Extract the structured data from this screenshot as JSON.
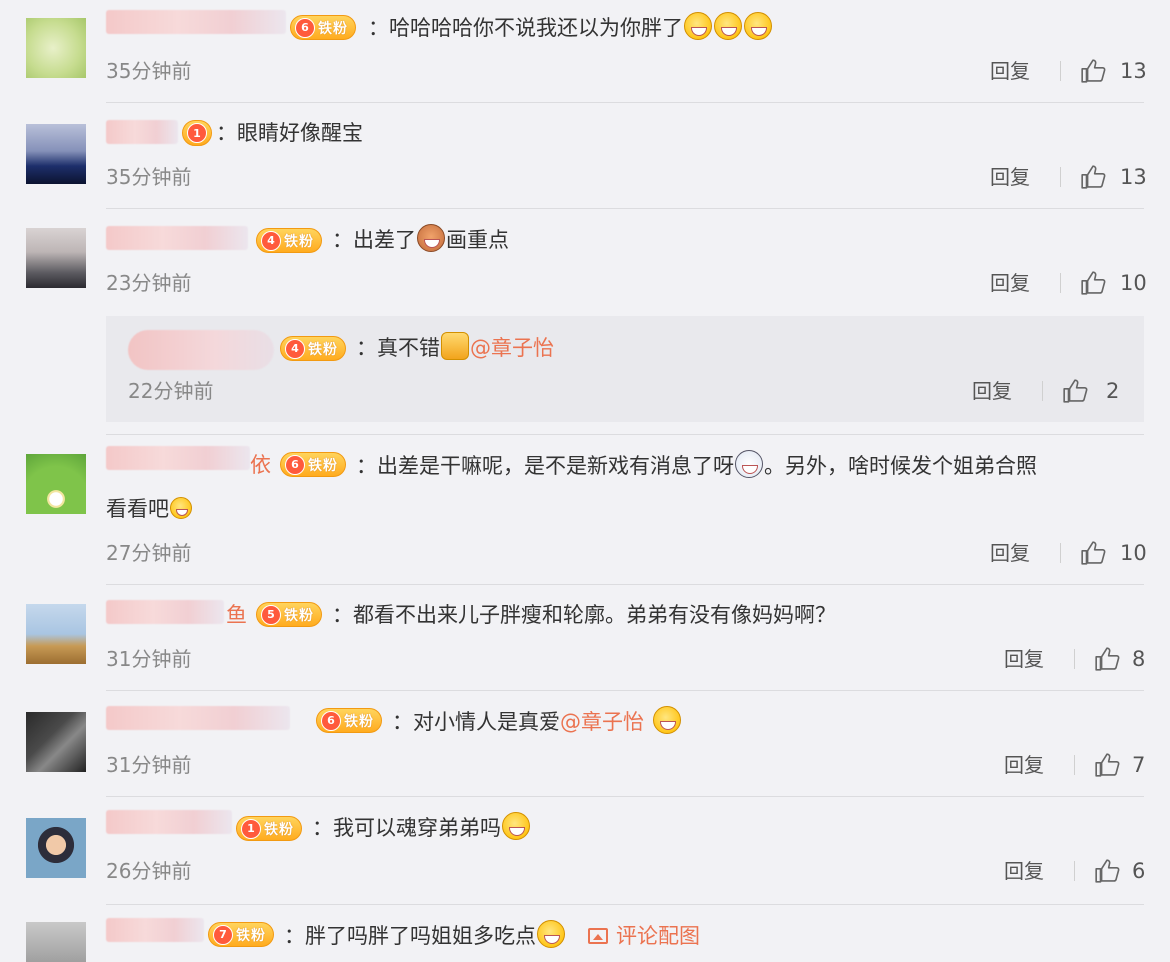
{
  "badge_label": "铁粉",
  "colon": "：",
  "reply_label": "回复",
  "comments": [
    {
      "level": "6",
      "name_tail": "",
      "text": "哈哈哈哈你不说我还以为你胖了",
      "time": "35分钟前",
      "likes": "13"
    },
    {
      "level": "1",
      "name_tail": "",
      "text": "眼睛好像醒宝",
      "time": "35分钟前",
      "likes": "13"
    },
    {
      "level": "4",
      "name_tail": "",
      "text_a": "出差了",
      "text_b": "画重点",
      "time": "23分钟前",
      "likes": "10",
      "sub": {
        "level": "4",
        "text": "真不错",
        "mention": "@章子怡",
        "time": "22分钟前",
        "likes": "2"
      }
    },
    {
      "level": "6",
      "name_tail": "依",
      "text_a": "出差是干嘛呢，是不是新戏有消息了呀",
      "text_b": "。另外，啥时候发个姐弟合照",
      "text_line2": "看看吧",
      "time": "27分钟前",
      "likes": "10"
    },
    {
      "level": "5",
      "name_tail": "鱼",
      "text": "都看不出来儿子胖瘦和轮廓。弟弟有没有像妈妈啊？",
      "time": "31分钟前",
      "likes": "8"
    },
    {
      "level": "6",
      "name_tail": "",
      "text": "对小情人是真爱",
      "mention": "@章子怡",
      "time": "31分钟前",
      "likes": "7"
    },
    {
      "level": "1",
      "name_tail": "",
      "text": "我可以魂穿弟弟吗",
      "time": "26分钟前",
      "likes": "6"
    },
    {
      "level": "7",
      "name_tail": "",
      "text": "胖了吗胖了吗姐姐多吃点",
      "pic_comment": "评论配图"
    }
  ],
  "colors": {
    "accent": "#eb7350",
    "background": "#f2f2f5",
    "badge": "#ffab1f"
  }
}
